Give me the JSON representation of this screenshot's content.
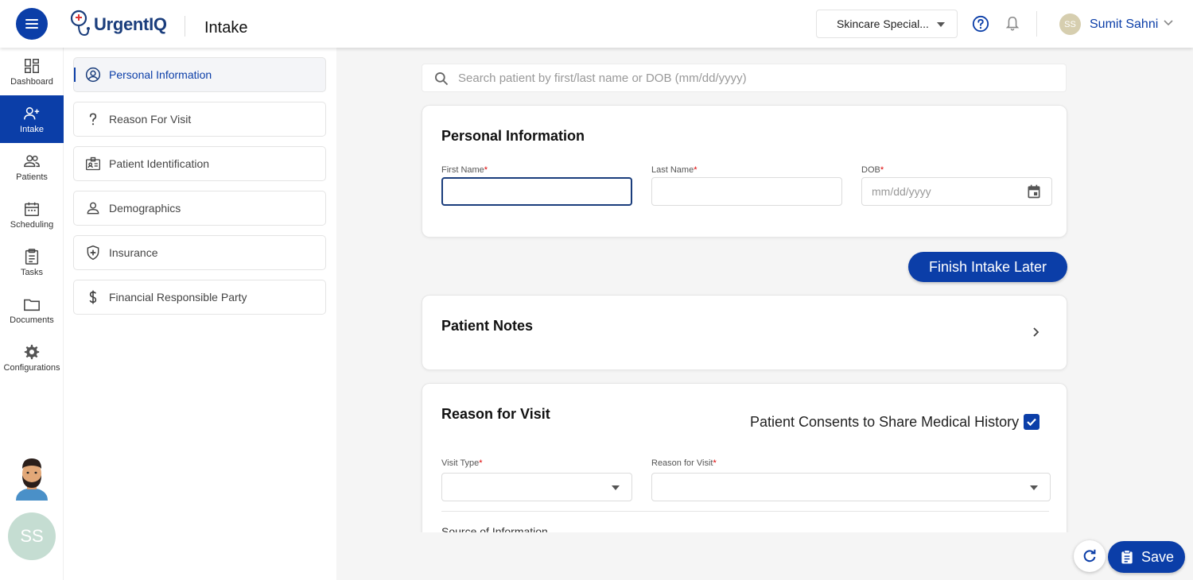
{
  "header": {
    "logo_text": "UrgentIQ",
    "page_title": "Intake",
    "location_select": "Skincare Special...",
    "user_initials": "SS",
    "user_name": "Sumit Sahni"
  },
  "leftnav": {
    "items": [
      {
        "label": "Dashboard",
        "icon": "dashboard-icon"
      },
      {
        "label": "Intake",
        "icon": "add-person-icon",
        "active": true
      },
      {
        "label": "Patients",
        "icon": "people-icon"
      },
      {
        "label": "Scheduling",
        "icon": "calendar-icon"
      },
      {
        "label": "Tasks",
        "icon": "clipboard-icon"
      },
      {
        "label": "Documents",
        "icon": "folder-icon"
      },
      {
        "label": "Configurations",
        "icon": "gear-icon"
      }
    ],
    "avatar_initials": "SS"
  },
  "subnav": {
    "items": [
      {
        "label": "Personal Information",
        "icon": "account-circle-icon",
        "active": true
      },
      {
        "label": "Reason For Visit",
        "icon": "question-icon"
      },
      {
        "label": "Patient Identification",
        "icon": "id-card-icon"
      },
      {
        "label": "Demographics",
        "icon": "person-icon"
      },
      {
        "label": "Insurance",
        "icon": "shield-plus-icon"
      },
      {
        "label": "Financial Responsible Party",
        "icon": "dollar-icon"
      }
    ]
  },
  "search": {
    "placeholder": "Search patient by first/last name or DOB (mm/dd/yyyy)"
  },
  "personal_info": {
    "title": "Personal Information",
    "first_name_label": "First Name",
    "last_name_label": "Last Name",
    "dob_label": "DOB",
    "required_mark": "*",
    "first_name_value": "",
    "last_name_value": "",
    "dob_placeholder": "mm/dd/yyyy"
  },
  "finish_button": "Finish Intake Later",
  "patient_notes": {
    "title": "Patient Notes"
  },
  "reason_for_visit": {
    "title": "Reason for Visit",
    "consent_label": "Patient Consents to Share Medical History",
    "consent_checked": true,
    "visit_type_label": "Visit Type",
    "reason_label": "Reason for Visit",
    "source_label": "Source of Information"
  },
  "footer": {
    "save_label": "Save"
  },
  "colors": {
    "primary": "#0b3ea8",
    "required": "#dd0000"
  }
}
